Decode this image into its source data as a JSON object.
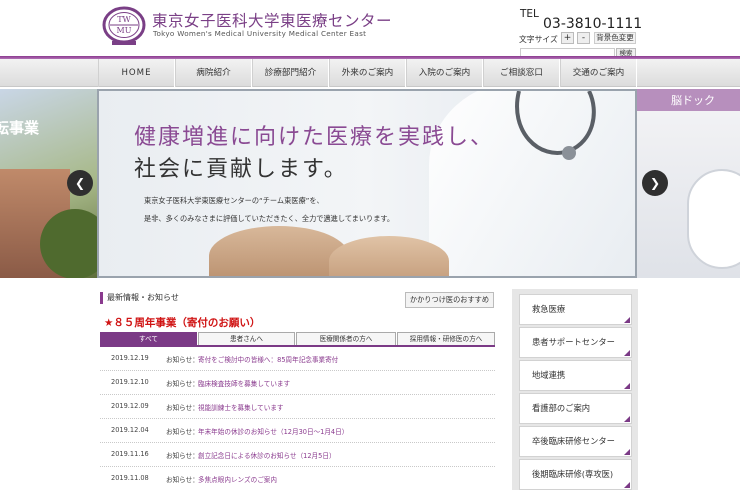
{
  "header": {
    "logo_emblem_text": "TWMU",
    "title": "東京女子医科大学東医療センター",
    "subtitle": "Tokyo Women's Medical University Medical Center East",
    "tel_label": "TEL",
    "tel_number": "03-3810-1111",
    "font_size_label": "文字サイズ",
    "font_plus": "+",
    "font_minus": "-",
    "bg_color_label": "背景色変更",
    "search_placeholder": "",
    "search_button": "検索"
  },
  "nav": {
    "items": [
      "HOME",
      "病院紹介",
      "診療部門紹介",
      "外来のご案内",
      "入院のご案内",
      "ご相談窓口",
      "交通のご案内"
    ]
  },
  "hero": {
    "left_caption": "転事業",
    "heading_line1": "健康増進に向けた医療を実践し、",
    "heading_line2": "社会に貢献します。",
    "body_line1": "東京女子医科大学東医療センターの“チーム東医療”を、",
    "body_line2": "是非、多くのみなさまに評価していただきたく、全力で邁進してまいります。",
    "right_caption": "脳ドック",
    "prev_icon": "chevron-left",
    "next_icon": "chevron-right"
  },
  "news": {
    "title": "最新情報・お知らせ",
    "clinic_button": "かかりつけ医のおすすめ",
    "anniversary_link": "★８５周年事業（寄付のお願い）",
    "tabs": [
      "すべて",
      "患者さんへ",
      "医療関係者の方へ",
      "採用情報・研修医の方へ"
    ],
    "items": [
      {
        "date": "2019.12.19",
        "category": "お知らせ：",
        "text": "寄付をご検討中の皆様へ：85周年記念事業寄付"
      },
      {
        "date": "2019.12.10",
        "category": "お知らせ：",
        "text": "臨床検査技師を募集しています"
      },
      {
        "date": "2019.12.09",
        "category": "お知らせ：",
        "text": "視能訓練士を募集しています"
      },
      {
        "date": "2019.12.04",
        "category": "お知らせ：",
        "text": "年末年始の休診のお知らせ（12月30日〜1月4日）"
      },
      {
        "date": "2019.11.16",
        "category": "お知らせ：",
        "text": "創立記念日による休診のお知らせ（12月5日）"
      },
      {
        "date": "2019.11.08",
        "category": "お知らせ：",
        "text": "多焦点眼内レンズのご案内"
      }
    ]
  },
  "sidebar": {
    "items": [
      "救急医療",
      "患者サポートセンター",
      "地域連携",
      "看護部のご案内",
      "卒後臨床研修センター",
      "後期臨床研修(専攻医)"
    ]
  },
  "colors": {
    "brand_purple": "#7b3a86",
    "alert_red": "#d01414"
  }
}
